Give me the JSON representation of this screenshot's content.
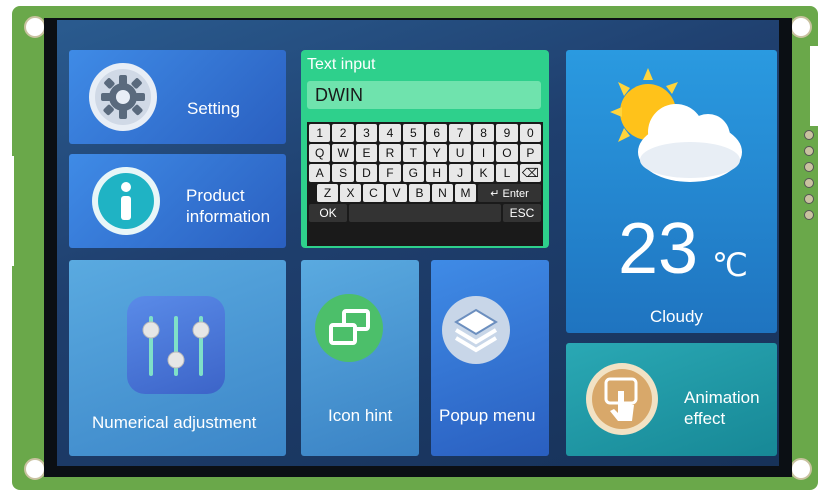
{
  "tiles": {
    "setting": "Setting",
    "product_line1": "Product",
    "product_line2": "information",
    "numerical": "Numerical adjustment",
    "icon_hint": "Icon hint",
    "popup_menu": "Popup menu",
    "animation_line1": "Animation",
    "animation_line2": "effect"
  },
  "keyboard": {
    "title": "Text input",
    "value": "DWIN",
    "row1": [
      "1",
      "2",
      "3",
      "4",
      "5",
      "6",
      "7",
      "8",
      "9",
      "0"
    ],
    "row2": [
      "Q",
      "W",
      "E",
      "R",
      "T",
      "Y",
      "U",
      "I",
      "O",
      "P"
    ],
    "row3": [
      "A",
      "S",
      "D",
      "F",
      "G",
      "H",
      "J",
      "K",
      "L",
      "⌫"
    ],
    "row4": [
      "Z",
      "X",
      "C",
      "V",
      "B",
      "N",
      "M",
      "↵ Enter"
    ],
    "ok": "OK",
    "esc": "ESC"
  },
  "weather": {
    "temperature": "23",
    "unit": "℃",
    "condition": "Cloudy"
  },
  "colors": {
    "accent_green": "#2ed08c",
    "tile_blue": "#2f6fd0",
    "weather_blue": "#2a8fd8",
    "teal": "#1a9aa8"
  }
}
